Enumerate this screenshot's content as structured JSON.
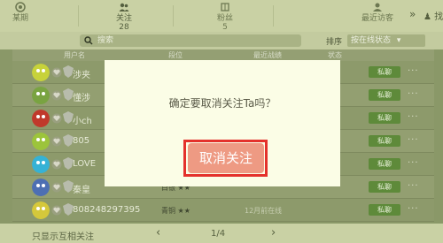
{
  "tabs": {
    "home": "某期",
    "follow": "关注",
    "follow_count": "28",
    "fans": "粉丝",
    "fans_count": "5",
    "visit": "最近访客",
    "more": "»",
    "find": "找朋友"
  },
  "search": {
    "placeholder": "搜索",
    "sort_label": "排序",
    "sort_value": "按在线状态"
  },
  "table": {
    "headers": [
      "用户名",
      "段位",
      "最近战绩",
      "状态"
    ]
  },
  "rows": [
    {
      "name": "涉夹",
      "action": "私聊",
      "more": "···",
      "avatar_color": "#c7d23a"
    },
    {
      "name": "懂涉",
      "action": "私聊",
      "more": "···",
      "avatar_color": "#79a341"
    },
    {
      "name": "小ch",
      "action": "私聊",
      "more": "···",
      "avatar_color": "#c0392b"
    },
    {
      "name": "805",
      "action": "私聊",
      "more": "···",
      "avatar_color": "#9cc43b"
    },
    {
      "name": "LOVE",
      "action": "私聊",
      "more": "···",
      "avatar_color": "#35b2d6"
    },
    {
      "name": "秦皇",
      "action": "私聊",
      "more": "···",
      "avatar_color": "#4d6fb3",
      "rank": "白银 ★★"
    },
    {
      "name": "808248297395",
      "action": "私聊",
      "more": "···",
      "avatar_color": "#d5c83b",
      "rank": "青铜 ★★",
      "status": "12月前在线"
    }
  ],
  "footer": {
    "only_mutual": "只显示互相关注",
    "page": "1/4",
    "prev": "‹",
    "next": "›"
  },
  "modal": {
    "message": "确定要取消关注Ta吗？",
    "confirm": "取消关注"
  },
  "colors": {
    "confirm_bg": "#ee9a83",
    "highlight": "#e4312b",
    "action_btn": "#5e8a3a"
  }
}
